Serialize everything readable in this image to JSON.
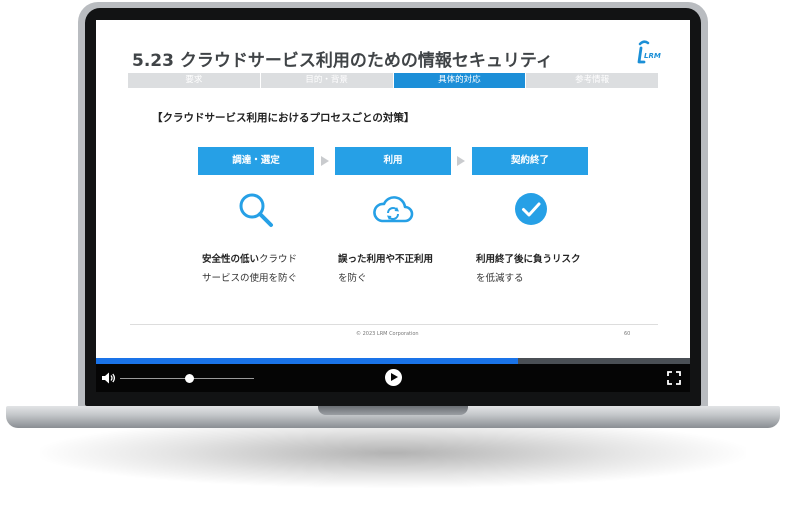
{
  "slide": {
    "title": "5.23 クラウドサービス利用のための情報セキュリティ",
    "logo_text": "LRM",
    "tabs": [
      {
        "label": "要求",
        "active": false
      },
      {
        "label": "目的・背景",
        "active": false
      },
      {
        "label": "具体的対応",
        "active": true
      },
      {
        "label": "参考情報",
        "active": false
      }
    ],
    "subtitle": "【クラウドサービス利用におけるプロセスごとの対策】",
    "steps": [
      {
        "label": "調達・選定",
        "icon": "magnifier-icon",
        "desc_bold": "安全性の低い",
        "desc_rest": "クラウド",
        "desc_line2": "サービスの使用を防ぐ"
      },
      {
        "label": "利用",
        "icon": "cloud-sync-icon",
        "desc_bold": "誤った利用や不正利用",
        "desc_rest": "",
        "desc_line2": "を防ぐ"
      },
      {
        "label": "契約終了",
        "icon": "check-circle-icon",
        "desc_bold": "利用終了後に負うリスク",
        "desc_rest": "",
        "desc_line2": "を低減する"
      }
    ],
    "copyright": "© 2023 LRM Corporation",
    "page_number": "60"
  },
  "player": {
    "progress_fraction": 0.71,
    "volume_fraction": 0.52
  },
  "colors": {
    "accent": "#26a0e6",
    "tab_active": "#1c8fd8",
    "tab_inactive": "#dcdee0",
    "progress": "#1a73e8"
  }
}
